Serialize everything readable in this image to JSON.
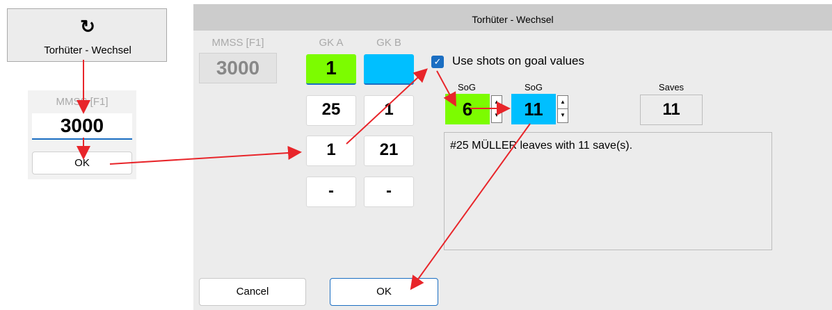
{
  "toolbar_button": {
    "icon": "refresh-icon",
    "label": "Torhüter - Wechsel"
  },
  "time_panel": {
    "label": "MMSS [F1]",
    "value": "3000",
    "ok_label": "OK"
  },
  "dialog": {
    "title": "Torhüter - Wechsel",
    "time": {
      "label": "MMSS [F1]",
      "value": "3000"
    },
    "gk_a": {
      "label": "GK A",
      "color": "#7cfc00",
      "rows": [
        "1",
        "25",
        "1",
        "-"
      ]
    },
    "gk_b": {
      "label": "GK B",
      "color": "#00bfff",
      "rows": [
        "",
        "1",
        "21",
        "-"
      ]
    },
    "use_sog": {
      "label": "Use shots on goal values",
      "checked": true
    },
    "sog_a": {
      "label": "SoG",
      "value": "6"
    },
    "sog_b": {
      "label": "SoG",
      "value": "11"
    },
    "saves": {
      "label": "Saves",
      "value": "11"
    },
    "message": "#25 MÜLLER leaves with 11 save(s).",
    "cancel_label": "Cancel",
    "ok_label": "OK"
  },
  "colors": {
    "arrow": "#e8252a",
    "accent": "#1b6ec2"
  }
}
